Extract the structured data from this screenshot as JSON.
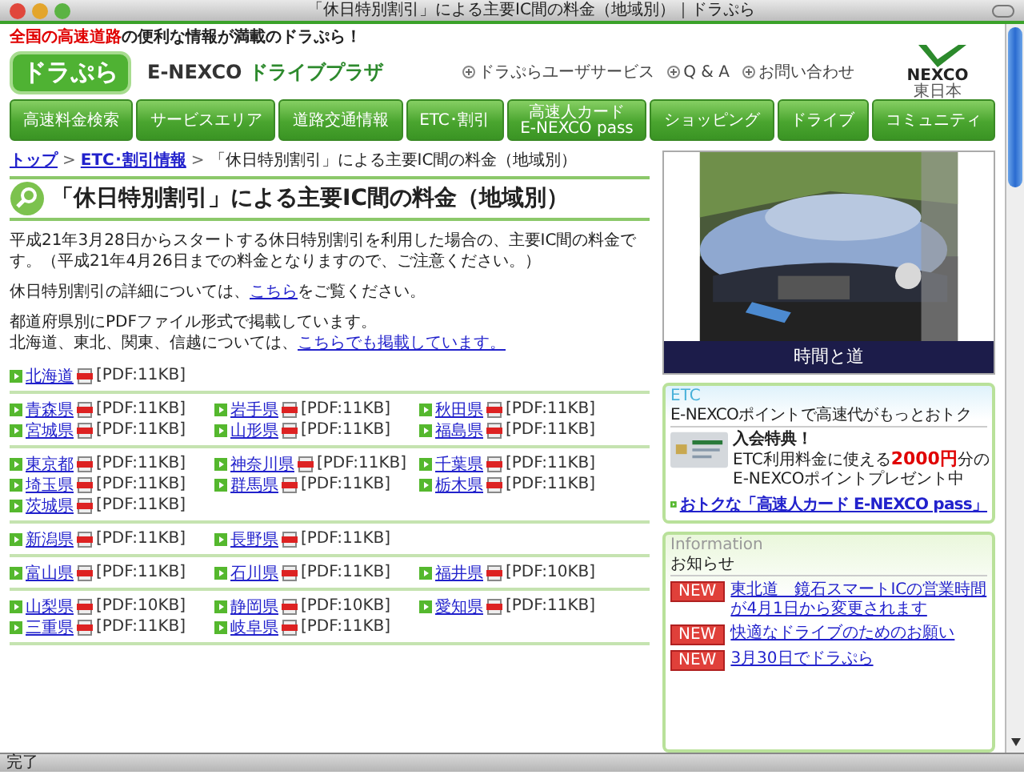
{
  "window": {
    "title": "「休日特別割引」による主要IC間の料金（地域別）｜ドラぷら"
  },
  "header": {
    "tagline_highlight": "全国の高速道路",
    "tagline_rest": "の便利な情報が満載のドラぷら！",
    "logo": "ドラぷら",
    "brand": "E-NEXCO",
    "brand_sub": "ドライブプラザ",
    "links": [
      "ドラぷらユーザサービス",
      "Q & A",
      "お問い合わせ"
    ],
    "corp_logo": "NEXCO",
    "corp_sub": "東日本"
  },
  "nav": [
    {
      "label": "高速料金検索"
    },
    {
      "label": "サービスエリア"
    },
    {
      "label": "道路交通情報"
    },
    {
      "label": "ETC･割引"
    },
    {
      "label": "高速人カード",
      "sub": "E-NEXCO pass"
    },
    {
      "label": "ショッピング"
    },
    {
      "label": "ドライブ"
    },
    {
      "label": "コミュニティ"
    }
  ],
  "breadcrumb": [
    {
      "label": "トップ",
      "link": true
    },
    {
      "sep": ">",
      "label": "ETC･割引情報",
      "link": true
    },
    {
      "sep": ">",
      "label": "「休日特別割引」による主要IC間の料金（地域別）"
    }
  ],
  "heading": "「休日特別割引」による主要IC間の料金（地域別）",
  "paragraphs": [
    {
      "lines": [
        [
          {
            "text": "平成21年3月28日からスタートする休日特別割引を利用した場合の、主要IC間の料金です。（平成21年4月26日までの料金となりますので、ご注意ください。）"
          }
        ]
      ]
    },
    {
      "lines": [
        [
          {
            "text": "休日特別割引の詳細については、"
          },
          {
            "text": "こちら",
            "link": true
          },
          {
            "text": "をご覧ください。"
          }
        ]
      ]
    },
    {
      "lines": [
        [
          {
            "text": "都道府県別にPDFファイル形式で掲載しています。"
          }
        ],
        [
          {
            "text": "北海道、東北、関東、信越については、"
          },
          {
            "text": "こちらでも掲載しています。",
            "link": true
          }
        ]
      ]
    }
  ],
  "sections": [
    {
      "items": [
        {
          "name": "北海道",
          "size": "[PDF:11KB]"
        }
      ]
    },
    {
      "items": [
        {
          "name": "青森県",
          "size": "[PDF:11KB]"
        },
        {
          "name": "岩手県",
          "size": "[PDF:11KB]"
        },
        {
          "name": "秋田県",
          "size": "[PDF:11KB]"
        },
        {
          "name": "宮城県",
          "size": "[PDF:11KB]"
        },
        {
          "name": "山形県",
          "size": "[PDF:11KB]"
        },
        {
          "name": "福島県",
          "size": "[PDF:11KB]"
        }
      ]
    },
    {
      "items": [
        {
          "name": "東京都",
          "size": "[PDF:11KB]"
        },
        {
          "name": "神奈川県",
          "size": "[PDF:11KB]"
        },
        {
          "name": "千葉県",
          "size": "[PDF:11KB]"
        },
        {
          "name": "埼玉県",
          "size": "[PDF:11KB]"
        },
        {
          "name": "群馬県",
          "size": "[PDF:11KB]"
        },
        {
          "name": "栃木県",
          "size": "[PDF:11KB]"
        },
        {
          "name": "茨城県",
          "size": "[PDF:11KB]"
        }
      ]
    },
    {
      "items": [
        {
          "name": "新潟県",
          "size": "[PDF:11KB]"
        },
        {
          "name": "長野県",
          "size": "[PDF:11KB]"
        }
      ]
    },
    {
      "items": [
        {
          "name": "富山県",
          "size": "[PDF:11KB]"
        },
        {
          "name": "石川県",
          "size": "[PDF:11KB]"
        },
        {
          "name": "福井県",
          "size": "[PDF:10KB]"
        }
      ]
    },
    {
      "items": [
        {
          "name": "山梨県",
          "size": "[PDF:10KB]"
        },
        {
          "name": "静岡県",
          "size": "[PDF:10KB]"
        },
        {
          "name": "愛知県",
          "size": "[PDF:11KB]"
        },
        {
          "name": "三重県",
          "size": "[PDF:11KB]"
        },
        {
          "name": "岐阜県",
          "size": "[PDF:11KB]"
        }
      ]
    }
  ],
  "sidebar": {
    "photo": {
      "kind": "picture",
      "caption": "時間と道"
    },
    "etc": {
      "label": "ETC",
      "title": "E-NEXCOポイントで高速代がもっとおトク",
      "benefit": "入会特典！",
      "text_before": "ETC利用料金に使える",
      "amount": "2000円",
      "text_after": "分の",
      "text_line2": "E-NEXCOポイントプレゼント中",
      "link": "おトクな「高速人カード E-NEXCO pass」"
    },
    "info": {
      "label": "Information",
      "title": "お知らせ",
      "news": [
        {
          "badge": "NEW",
          "text": "東北道　鏡石スマートICの営業時間が4月1日から変更されます"
        },
        {
          "badge": "NEW",
          "text": "快適なドライブのためのお願い"
        },
        {
          "badge": "NEW",
          "text": "3月30日でドラぷら"
        }
      ]
    }
  },
  "status_bar": "完了"
}
